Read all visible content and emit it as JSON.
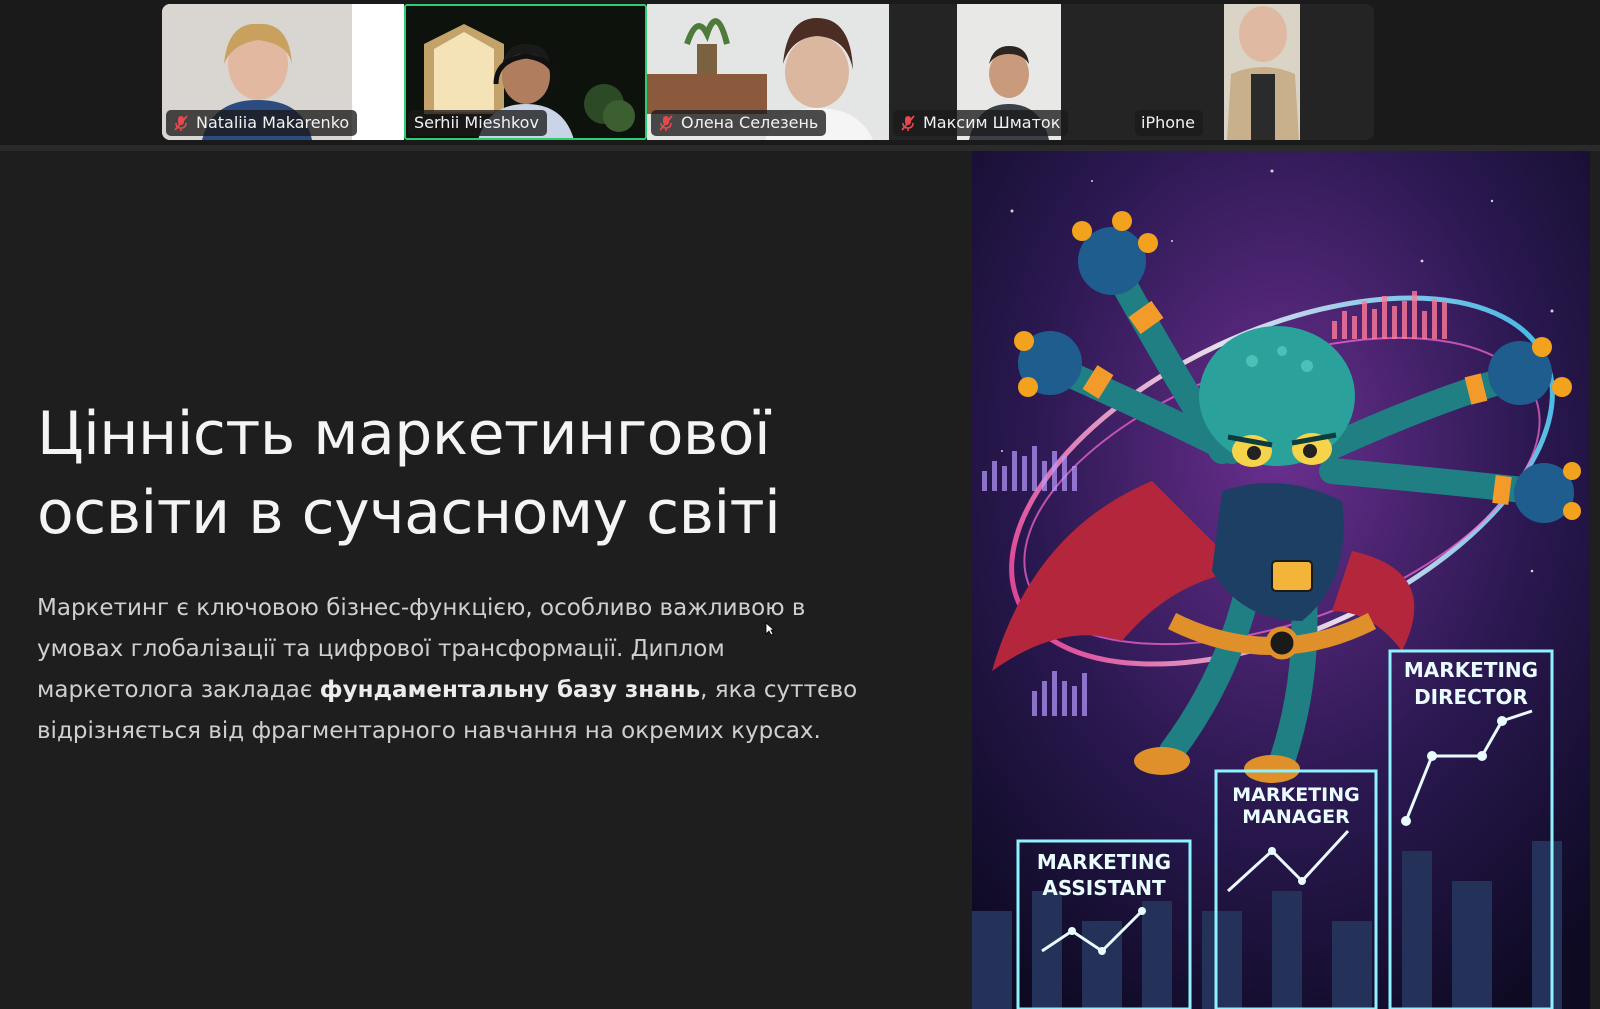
{
  "participants": [
    {
      "name": "Nataliia Makarenko",
      "muted": true,
      "active": false
    },
    {
      "name": "Serhii Mieshkov",
      "muted": false,
      "active": true
    },
    {
      "name": "Олена Селезень",
      "muted": true,
      "active": false
    },
    {
      "name": "Максим Шматок",
      "muted": true,
      "active": false
    },
    {
      "name": "iPhone",
      "muted": false,
      "active": false
    }
  ],
  "slide": {
    "title_line1": "Цінність маркетингової",
    "title_line2": "освіти в сучасному світі",
    "body_part1": "Маркетинг є ключовою бізнес-функцією, особливо важливою в умовах глобалізації та цифрової трансформації. Диплом маркетолога закладає ",
    "body_bold": "фундаментальну базу знань",
    "body_part2": ", яка суттєво відрізняється від фрагментарного навчання на окремих курсах."
  },
  "illustration": {
    "labels": {
      "assistant_line1": "MARKETING",
      "assistant_line2": "ASSISTANT",
      "manager_line1": "MARKETING",
      "manager_line2": "MANAGER",
      "director_line1": "MARKETING",
      "director_line2": "DIRECTOR"
    }
  },
  "colors": {
    "active_speaker": "#2ecc71",
    "mute_icon": "#e5484d",
    "slide_bg": "#1e1e1f",
    "title": "#f4f4f4",
    "body": "#cfcfcf"
  }
}
